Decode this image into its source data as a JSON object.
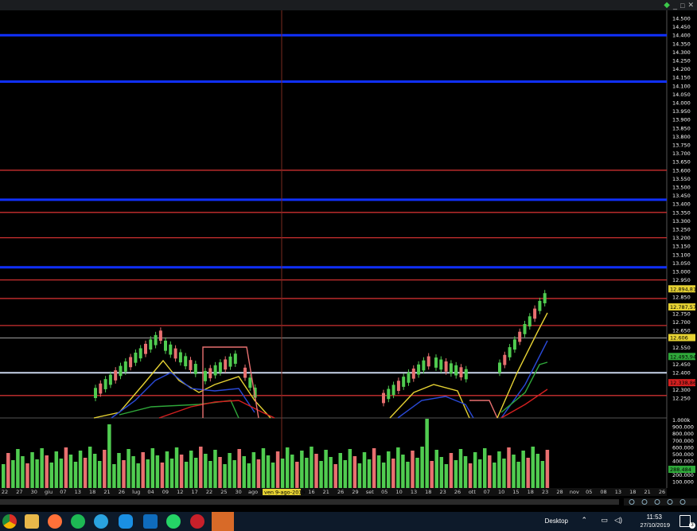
{
  "window": {
    "controls": [
      "_",
      "□",
      "✕"
    ]
  },
  "price_axis": {
    "labels": [
      "14.500",
      "14.450",
      "14.400",
      "14.350",
      "14.300",
      "14.250",
      "14.200",
      "14.150",
      "14.100",
      "14.050",
      "14.000",
      "13.950",
      "13.900",
      "13.850",
      "13.800",
      "13.750",
      "13.700",
      "13.650",
      "13.600",
      "13.550",
      "13.500",
      "13.450",
      "13.400",
      "13.350",
      "13.300",
      "13.250",
      "13.200",
      "13.150",
      "13.100",
      "13.050",
      "13.000",
      "12.950",
      "12.900",
      "12.850",
      "12.800",
      "12.750",
      "12.700",
      "12.650",
      "12.600",
      "12.550",
      "12.500",
      "12.450",
      "12.400",
      "12.350",
      "12.300",
      "12.250"
    ],
    "badges": [
      {
        "text": "12.894,81",
        "color": "#e6d233",
        "value": 12894.81
      },
      {
        "text": "12.787,57",
        "color": "#e6d233",
        "value": 12787.57
      },
      {
        "text": "12.606",
        "color": "#e6d233",
        "value": 12606
      },
      {
        "text": "12.493,94",
        "color": "#2fa83a",
        "value": 12493.94
      },
      {
        "text": "12.338,86",
        "color": "#d42020",
        "value": 12338.86
      }
    ]
  },
  "volume_axis": {
    "labels": [
      "1.000k",
      "900.000",
      "800.000",
      "700.000",
      "600.000",
      "500.000",
      "400.000",
      "300.000",
      "200.000",
      "100.000"
    ],
    "badge": {
      "text": "288.484",
      "color": "#2fa83a",
      "value": 288484
    }
  },
  "x_axis": {
    "labels": [
      "22",
      "27",
      "30",
      "giu",
      "07",
      "13",
      "18",
      "21",
      "26",
      "lug",
      "04",
      "09",
      "12",
      "17",
      "22",
      "25",
      "30",
      "ago",
      "05",
      "08",
      "13",
      "16",
      "21",
      "26",
      "29",
      "set",
      "05",
      "10",
      "13",
      "18",
      "23",
      "26",
      "ott",
      "07",
      "10",
      "15",
      "18",
      "23",
      "28",
      "nov",
      "05",
      "08",
      "13",
      "18",
      "21",
      "26"
    ],
    "crosshair_label": "ven 9-ago-2019"
  },
  "levels": [
    {
      "price": 14400,
      "color": "blue"
    },
    {
      "price": 14125,
      "color": "blue"
    },
    {
      "price": 13600,
      "color": "red"
    },
    {
      "price": 13425,
      "color": "blue"
    },
    {
      "price": 13350,
      "color": "red"
    },
    {
      "price": 13200,
      "color": "red"
    },
    {
      "price": 13025,
      "color": "blue"
    },
    {
      "price": 12950,
      "color": "red"
    },
    {
      "price": 12840,
      "color": "red"
    },
    {
      "price": 12680,
      "color": "red"
    },
    {
      "price": 12606,
      "color": "grey"
    },
    {
      "price": 12400,
      "color": "white"
    },
    {
      "price": 12265,
      "color": "red"
    }
  ],
  "colors": {
    "up": "#50cc50",
    "down": "#e87070",
    "ma_yellow": "#e6d233",
    "ma_blue": "#2a4ad8",
    "ma_green": "#2fa83a",
    "ma_red": "#d42020",
    "level_blue": "#1030ff",
    "level_red": "#cc3030"
  },
  "taskbar": {
    "icons": [
      "chrome-icon",
      "explorer-icon",
      "firefox-icon",
      "spotify-icon",
      "telegram-icon",
      "skype-icon",
      "outlook-icon",
      "whatsapp-icon",
      "app-icon",
      "trading-app-icon"
    ],
    "desktop_label": "Desktop",
    "time": "11:53",
    "date": "27/10/2019",
    "notif_count": "3"
  }
}
